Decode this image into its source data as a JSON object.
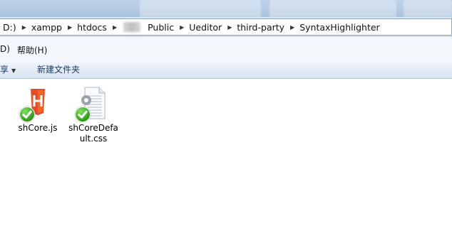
{
  "address_bar": {
    "crumbs_before": [
      "D:)",
      "xampp",
      "htdocs"
    ],
    "crumbs_after": [
      "Public",
      "Ueditor",
      "third-party",
      "SyntaxHighlighter"
    ]
  },
  "menu": {
    "left_fragment": "D)",
    "help": "帮助(H)"
  },
  "command_bar": {
    "share_fragment": "享",
    "new_folder": "新建文件夹"
  },
  "files": [
    {
      "name": "shCore.js",
      "icon": "html-file-icon"
    },
    {
      "name": "shCoreDefault.css",
      "icon": "css-file-icon"
    }
  ],
  "colors": {
    "html_icon": "#e44d26",
    "sync_check": "#2f9a1b",
    "address_border": "#8ea5bf"
  }
}
